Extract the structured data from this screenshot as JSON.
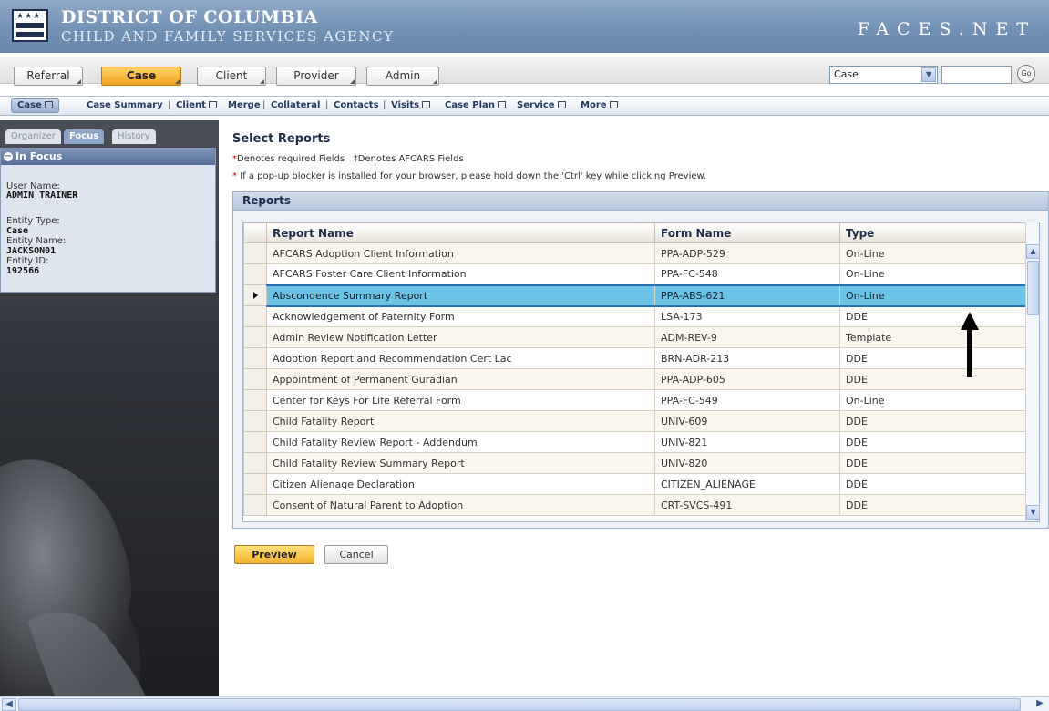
{
  "header": {
    "org_title": "DISTRICT OF COLUMBIA",
    "org_subtitle": "CHILD AND FAMILY SERVICES AGENCY",
    "app_name": "FACES.NET"
  },
  "modules": [
    {
      "label": "Referral",
      "active": false
    },
    {
      "label": "Case",
      "active": true
    },
    {
      "label": "Client",
      "active": false
    },
    {
      "label": "Provider",
      "active": false
    },
    {
      "label": "Admin",
      "active": false
    }
  ],
  "search": {
    "scope_value": "Case",
    "input_value": "",
    "go_label": "Go"
  },
  "subnav": {
    "active": "Case",
    "items": [
      "Case Summary",
      "Client",
      "Merge",
      "Collateral",
      "Contacts",
      "Visits",
      "Case Plan",
      "Service",
      "More"
    ]
  },
  "left_panel": {
    "tabs": [
      "Organizer",
      "Focus",
      "History"
    ],
    "active_tab": "Focus",
    "section_title": "In Focus",
    "user_name_label": "User Name:",
    "user_name": "ADMIN TRAINER",
    "entity_type_label": "Entity Type:",
    "entity_type": "Case",
    "entity_name_label": "Entity Name:",
    "entity_name": "JACKSON01",
    "entity_id_label": "Entity ID:",
    "entity_id": "192566"
  },
  "main": {
    "title": "Select Reports",
    "required_note": "Denotes required Fields",
    "afcars_note": "‡Denotes AFCARS Fields",
    "popup_note": "If a pop-up blocker is installed for your browser, please hold down the 'Ctrl' key while clicking Preview.",
    "panel_title": "Reports",
    "columns": [
      "Report Name",
      "Form Name",
      "Type"
    ],
    "rows": [
      {
        "report": "AFCARS Adoption Client Information",
        "form": "PPA-ADP-529",
        "type": "On-Line"
      },
      {
        "report": "AFCARS Foster Care Client Information",
        "form": "PPA-FC-548",
        "type": "On-Line"
      },
      {
        "report": "Abscondence Summary Report",
        "form": "PPA-ABS-621",
        "type": "On-Line",
        "selected": true
      },
      {
        "report": "Acknowledgement of Paternity Form",
        "form": "LSA-173",
        "type": "DDE"
      },
      {
        "report": "Admin Review Notification Letter",
        "form": "ADM-REV-9",
        "type": "Template"
      },
      {
        "report": "Adoption Report and Recommendation Cert Lac",
        "form": "BRN-ADR-213",
        "type": "DDE"
      },
      {
        "report": "Appointment of Permanent Guradian",
        "form": "PPA-ADP-605",
        "type": "DDE"
      },
      {
        "report": "Center for Keys For Life Referral Form",
        "form": "PPA-FC-549",
        "type": "On-Line"
      },
      {
        "report": "Child Fatality Report",
        "form": "UNIV-609",
        "type": "DDE"
      },
      {
        "report": "Child Fatality Review Report - Addendum",
        "form": "UNIV-821",
        "type": "DDE"
      },
      {
        "report": "Child Fatality Review Summary Report",
        "form": "UNIV-820",
        "type": "DDE"
      },
      {
        "report": "Citizen Alienage Declaration",
        "form": "CITIZEN_ALIENAGE",
        "type": "DDE"
      },
      {
        "report": "Consent of Natural Parent to Adoption",
        "form": "CRT-SVCS-491",
        "type": "DDE"
      }
    ],
    "buttons": {
      "preview": "Preview",
      "cancel": "Cancel"
    }
  },
  "colors": {
    "banner": "#7391b5",
    "active_tab": "#f0a321",
    "selected_row": "#6bc4e6",
    "row_even": "#fbf6ed",
    "required_star": "#dd0000"
  }
}
